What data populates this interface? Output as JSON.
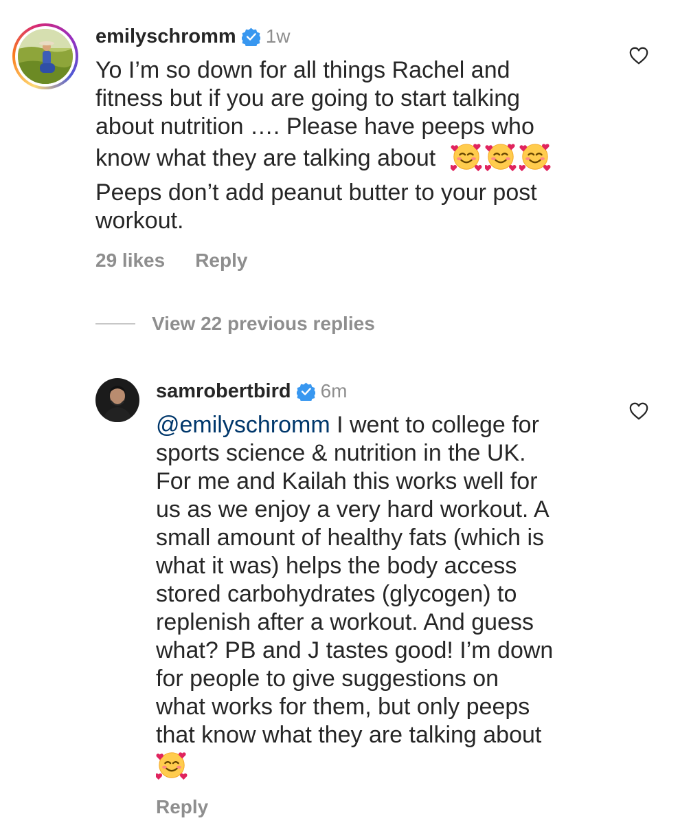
{
  "top_comment": {
    "username": "emilyschromm",
    "time": "1w",
    "text_lines": [
      "Yo I’m so down for all things Rachel and",
      "fitness but if you are going to start talking",
      "about nutrition …. Please have peeps who",
      "know what they are talking about"
    ],
    "emoji": [
      "smiling-face-with-hearts",
      "smiling-face-with-hearts",
      "smiling-face-with-hearts"
    ],
    "text_lines_2": [
      "Peeps don’t add peanut butter to your post",
      "workout."
    ],
    "likes": "29 likes",
    "reply": "Reply"
  },
  "view_replies": {
    "label": "View 22 previous replies"
  },
  "reply_comment": {
    "username": "samrobertbird",
    "time": "6m",
    "mention": "@emilyschromm",
    "text_first": " I went to college for",
    "text_lines": [
      "sports science & nutrition in the UK.",
      "For me and Kailah this works well for",
      "us as we enjoy a very hard workout. A",
      "small amount of healthy fats (which is",
      "what it was) helps the body access",
      "stored carbohydrates (glycogen) to",
      "replenish after a workout. And guess",
      "what? PB and J tastes good! I’m down",
      "for people to give suggestions on",
      "what works for them, but only peeps",
      "that know what they are talking about"
    ],
    "emoji": [
      "smiling-face-with-hearts"
    ],
    "reply": "Reply"
  },
  "colors": {
    "text": "#262626",
    "muted": "#8e8e8e",
    "verified": "#3897f0",
    "mention": "#00376b"
  }
}
